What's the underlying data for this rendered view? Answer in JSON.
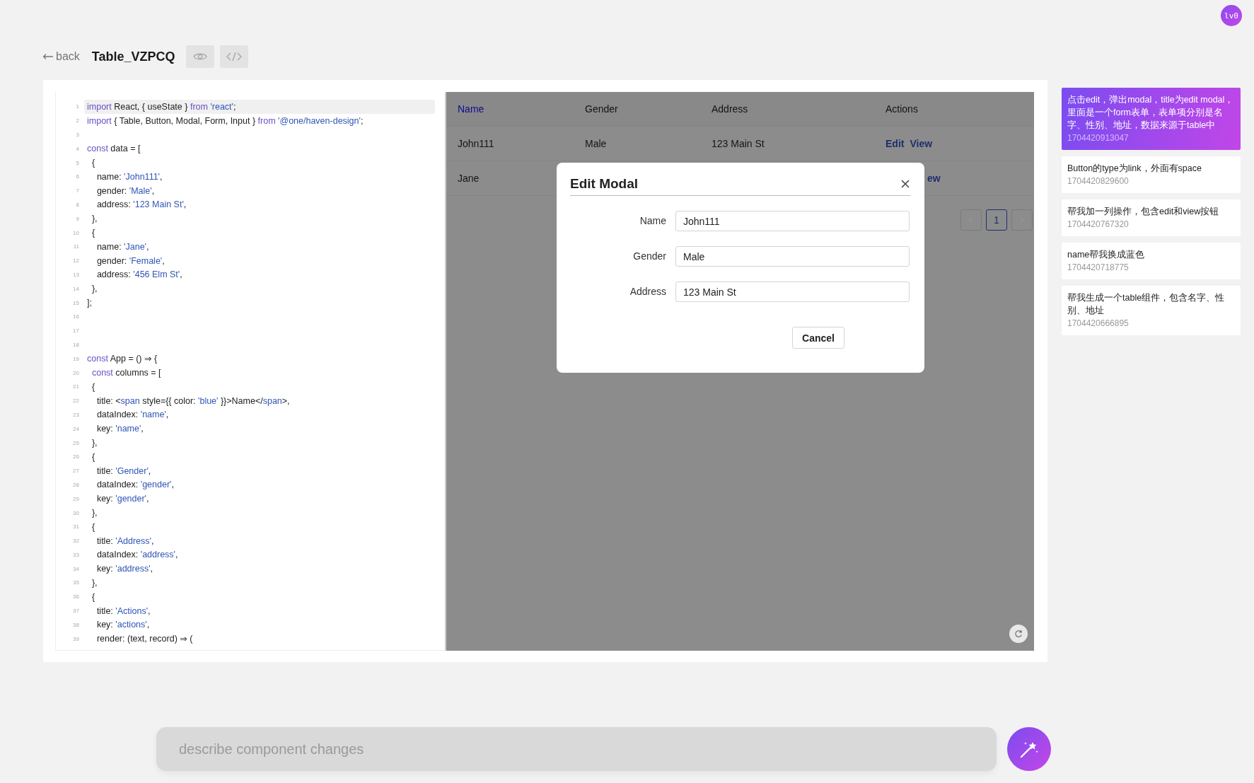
{
  "avatar": {
    "label": "lv0"
  },
  "header": {
    "back": "back",
    "title": "Table_VZPCQ"
  },
  "editor": {
    "lines": [
      {
        "n": "1",
        "highlighted": true,
        "tokens": [
          {
            "kind": "keyword",
            "text": "import"
          },
          {
            "kind": "plain",
            "text": " React, { useState } "
          },
          {
            "kind": "keyword",
            "text": "from"
          },
          {
            "kind": "string",
            "text": " 'react'"
          },
          {
            "kind": "plain",
            "text": ";"
          }
        ]
      },
      {
        "n": "2",
        "highlighted": false,
        "tokens": [
          {
            "kind": "keyword",
            "text": "import"
          },
          {
            "kind": "plain",
            "text": " { Table, Button, Modal, Form, Input } "
          },
          {
            "kind": "keyword",
            "text": "from"
          },
          {
            "kind": "string",
            "text": " '@one/haven-design'"
          },
          {
            "kind": "plain",
            "text": ";"
          }
        ]
      },
      {
        "n": "3",
        "highlighted": false
      },
      {
        "n": "4",
        "highlighted": false,
        "tokens": [
          {
            "kind": "keyword",
            "text": "const"
          },
          {
            "kind": "plain",
            "text": " data = ["
          }
        ]
      },
      {
        "n": "5",
        "highlighted": false,
        "tokens": [
          {
            "kind": "plain",
            "text": "  {"
          }
        ]
      },
      {
        "n": "6",
        "highlighted": false,
        "tokens": [
          {
            "kind": "plain",
            "text": "    name: "
          },
          {
            "kind": "string",
            "text": "'John111'"
          },
          {
            "kind": "plain",
            "text": ","
          }
        ]
      },
      {
        "n": "7",
        "highlighted": false,
        "tokens": [
          {
            "kind": "plain",
            "text": "    gender: "
          },
          {
            "kind": "string",
            "text": "'Male'"
          },
          {
            "kind": "plain",
            "text": ","
          }
        ]
      },
      {
        "n": "8",
        "highlighted": false,
        "tokens": [
          {
            "kind": "plain",
            "text": "    address: "
          },
          {
            "kind": "string",
            "text": "'123 Main St'"
          },
          {
            "kind": "plain",
            "text": ","
          }
        ]
      },
      {
        "n": "9",
        "highlighted": false,
        "tokens": [
          {
            "kind": "plain",
            "text": "  },"
          }
        ]
      },
      {
        "n": "10",
        "highlighted": false,
        "tokens": [
          {
            "kind": "plain",
            "text": "  {"
          }
        ]
      },
      {
        "n": "11",
        "highlighted": false,
        "tokens": [
          {
            "kind": "plain",
            "text": "    name: "
          },
          {
            "kind": "string",
            "text": "'Jane'"
          },
          {
            "kind": "plain",
            "text": ","
          }
        ]
      },
      {
        "n": "12",
        "highlighted": false,
        "tokens": [
          {
            "kind": "plain",
            "text": "    gender: "
          },
          {
            "kind": "string",
            "text": "'Female'"
          },
          {
            "kind": "plain",
            "text": ","
          }
        ]
      },
      {
        "n": "13",
        "highlighted": false,
        "tokens": [
          {
            "kind": "plain",
            "text": "    address: "
          },
          {
            "kind": "string",
            "text": "'456 Elm St'"
          },
          {
            "kind": "plain",
            "text": ","
          }
        ]
      },
      {
        "n": "14",
        "highlighted": false,
        "tokens": [
          {
            "kind": "plain",
            "text": "  },"
          }
        ]
      },
      {
        "n": "15",
        "highlighted": false,
        "tokens": [
          {
            "kind": "plain",
            "text": "];"
          }
        ]
      },
      {
        "n": "16",
        "highlighted": false
      },
      {
        "n": "17",
        "highlighted": false
      },
      {
        "n": "18",
        "highlighted": false
      },
      {
        "n": "19",
        "highlighted": false,
        "tokens": [
          {
            "kind": "keyword",
            "text": "const"
          },
          {
            "kind": "plain",
            "text": " App = () ⇒ {"
          }
        ]
      },
      {
        "n": "20",
        "highlighted": false,
        "tokens": [
          {
            "kind": "keyword",
            "text": "  const"
          },
          {
            "kind": "plain",
            "text": " columns = ["
          }
        ]
      },
      {
        "n": "21",
        "highlighted": false,
        "tokens": [
          {
            "kind": "plain",
            "text": "  {"
          }
        ]
      },
      {
        "n": "22",
        "highlighted": false,
        "tokens": [
          {
            "kind": "plain",
            "text": "    title: <"
          },
          {
            "kind": "string",
            "text": "span"
          },
          {
            "kind": "plain",
            "text": " style={{ color: "
          },
          {
            "kind": "string",
            "text": "'blue'"
          },
          {
            "kind": "plain",
            "text": " }}>Name</"
          },
          {
            "kind": "string",
            "text": "span"
          },
          {
            "kind": "plain",
            "text": ">,"
          }
        ]
      },
      {
        "n": "23",
        "highlighted": false,
        "tokens": [
          {
            "kind": "plain",
            "text": "    dataIndex: "
          },
          {
            "kind": "string",
            "text": "'name'"
          },
          {
            "kind": "plain",
            "text": ","
          }
        ]
      },
      {
        "n": "24",
        "highlighted": false,
        "tokens": [
          {
            "kind": "plain",
            "text": "    key: "
          },
          {
            "kind": "string",
            "text": "'name'"
          },
          {
            "kind": "plain",
            "text": ","
          }
        ]
      },
      {
        "n": "25",
        "highlighted": false,
        "tokens": [
          {
            "kind": "plain",
            "text": "  },"
          }
        ]
      },
      {
        "n": "26",
        "highlighted": false,
        "tokens": [
          {
            "kind": "plain",
            "text": "  {"
          }
        ]
      },
      {
        "n": "27",
        "highlighted": false,
        "tokens": [
          {
            "kind": "plain",
            "text": "    title: "
          },
          {
            "kind": "string",
            "text": "'Gender'"
          },
          {
            "kind": "plain",
            "text": ","
          }
        ]
      },
      {
        "n": "28",
        "highlighted": false,
        "tokens": [
          {
            "kind": "plain",
            "text": "    dataIndex: "
          },
          {
            "kind": "string",
            "text": "'gender'"
          },
          {
            "kind": "plain",
            "text": ","
          }
        ]
      },
      {
        "n": "29",
        "highlighted": false,
        "tokens": [
          {
            "kind": "plain",
            "text": "    key: "
          },
          {
            "kind": "string",
            "text": "'gender'"
          },
          {
            "kind": "plain",
            "text": ","
          }
        ]
      },
      {
        "n": "30",
        "highlighted": false,
        "tokens": [
          {
            "kind": "plain",
            "text": "  },"
          }
        ]
      },
      {
        "n": "31",
        "highlighted": false,
        "tokens": [
          {
            "kind": "plain",
            "text": "  {"
          }
        ]
      },
      {
        "n": "32",
        "highlighted": false,
        "tokens": [
          {
            "kind": "plain",
            "text": "    title: "
          },
          {
            "kind": "string",
            "text": "'Address'"
          },
          {
            "kind": "plain",
            "text": ","
          }
        ]
      },
      {
        "n": "33",
        "highlighted": false,
        "tokens": [
          {
            "kind": "plain",
            "text": "    dataIndex: "
          },
          {
            "kind": "string",
            "text": "'address'"
          },
          {
            "kind": "plain",
            "text": ","
          }
        ]
      },
      {
        "n": "34",
        "highlighted": false,
        "tokens": [
          {
            "kind": "plain",
            "text": "    key: "
          },
          {
            "kind": "string",
            "text": "'address'"
          },
          {
            "kind": "plain",
            "text": ","
          }
        ]
      },
      {
        "n": "35",
        "highlighted": false,
        "tokens": [
          {
            "kind": "plain",
            "text": "  },"
          }
        ]
      },
      {
        "n": "36",
        "highlighted": false,
        "tokens": [
          {
            "kind": "plain",
            "text": "  {"
          }
        ]
      },
      {
        "n": "37",
        "highlighted": false,
        "tokens": [
          {
            "kind": "plain",
            "text": "    title: "
          },
          {
            "kind": "string",
            "text": "'Actions'"
          },
          {
            "kind": "plain",
            "text": ","
          }
        ]
      },
      {
        "n": "38",
        "highlighted": false,
        "tokens": [
          {
            "kind": "plain",
            "text": "    key: "
          },
          {
            "kind": "string",
            "text": "'actions'"
          },
          {
            "kind": "plain",
            "text": ","
          }
        ]
      },
      {
        "n": "39",
        "highlighted": false,
        "tokens": [
          {
            "kind": "plain",
            "text": "    render: (text, record) ⇒ ("
          }
        ]
      }
    ]
  },
  "preview": {
    "table": {
      "columns": [
        {
          "label": "Name",
          "color": "#0d0d8f"
        },
        {
          "label": "Gender",
          "color": "#141414"
        },
        {
          "label": "Address",
          "color": "#141414"
        },
        {
          "label": "Actions",
          "color": "#141414"
        }
      ],
      "rows": [
        {
          "cells": [
            "John111",
            "Male",
            "123 Main St"
          ],
          "actions": [
            "Edit",
            "View"
          ]
        },
        {
          "cells": [
            "Jane"
          ],
          "actions": [
            "ew"
          ]
        }
      ]
    },
    "pagination": {
      "pages": [
        {
          "label": "1",
          "selected": true
        }
      ]
    },
    "modal": {
      "title": "Edit Modal",
      "fields": [
        {
          "label": "Name",
          "value": "John111"
        },
        {
          "label": "Gender",
          "value": "Male"
        },
        {
          "label": "Address",
          "value": "123 Main St"
        }
      ],
      "buttons": [
        "Cancel"
      ]
    }
  },
  "history": [
    {
      "text": "点击edit，弹出modal，title为edit modal，里面是一个form表单，表单项分别是名字、性别、地址，数据来源于table中",
      "time": "1704420913047",
      "selected": true
    },
    {
      "text": "Button的type为link，外面有space",
      "time": "1704420829600",
      "selected": false
    },
    {
      "text": "帮我加一列操作，包含edit和view按钮",
      "time": "1704420767320",
      "selected": false
    },
    {
      "text": "name帮我换成蓝色",
      "time": "1704420718775",
      "selected": false
    },
    {
      "text": "帮我生成一个table组件，包含名字、性别、地址",
      "time": "1704420666895",
      "selected": false
    }
  ],
  "prompt": {
    "placeholder": "describe component changes"
  }
}
